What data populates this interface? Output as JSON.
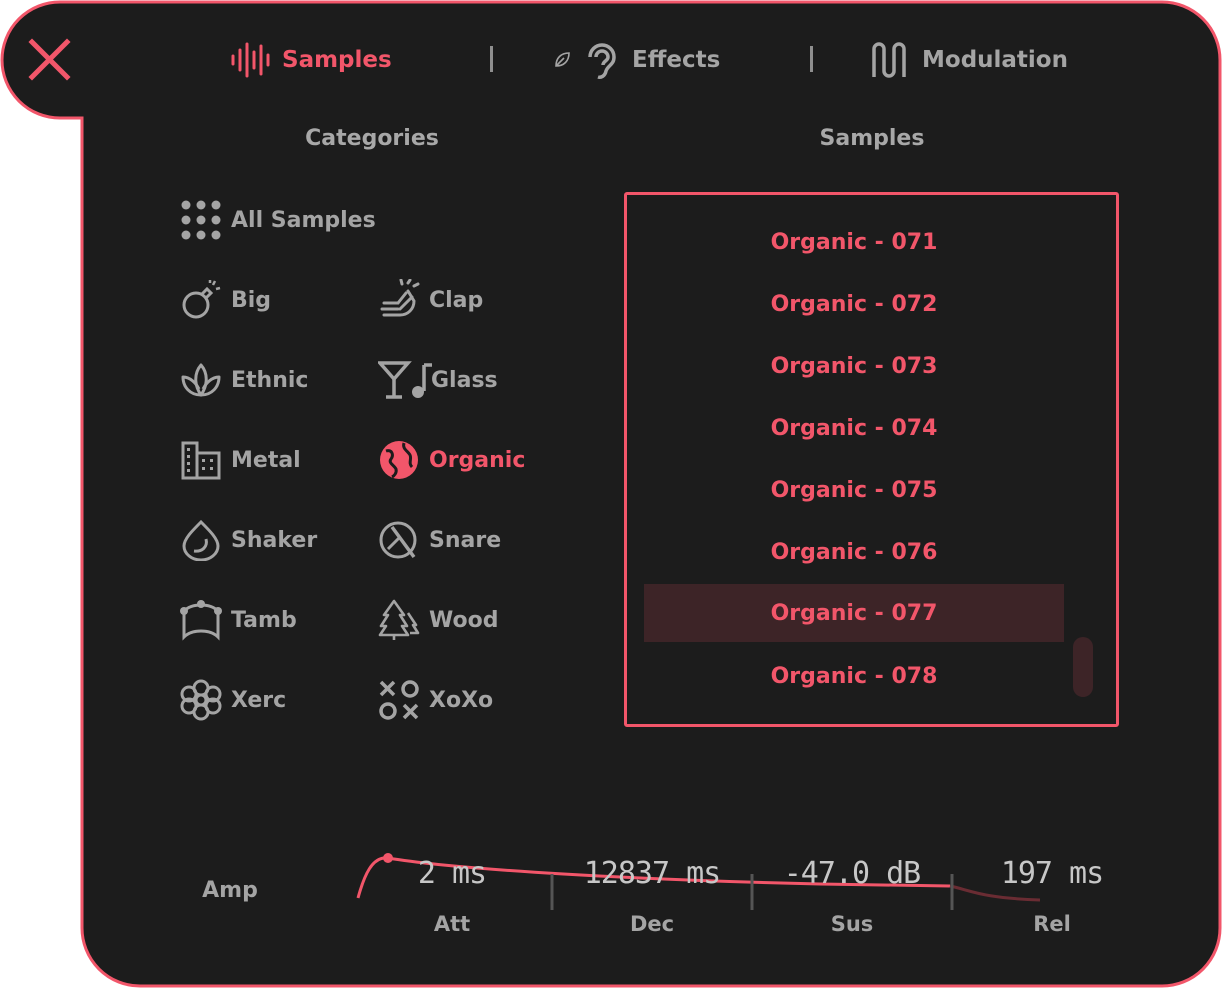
{
  "colors": {
    "accent": "#f2566a",
    "panel": "#1c1c1c",
    "text_muted": "#a4a4a4",
    "selected_row": "#3d2427"
  },
  "close_icon": "close-x-icon",
  "tabs": [
    {
      "label": "Samples",
      "icon": "waveform-bars-icon",
      "active": true
    },
    {
      "label": "Effects",
      "icon": "ear-icon",
      "active": false
    },
    {
      "label": "Modulation",
      "icon": "wave-squiggle-icon",
      "active": false
    }
  ],
  "categories": {
    "heading": "Categories",
    "all_label": "All Samples",
    "items": [
      {
        "label": "Big",
        "icon": "bomb-icon"
      },
      {
        "label": "Clap",
        "icon": "clap-hands-icon"
      },
      {
        "label": "Ethnic",
        "icon": "lotus-icon"
      },
      {
        "label": "Glass",
        "icon": "glass-note-icon"
      },
      {
        "label": "Metal",
        "icon": "building-icon"
      },
      {
        "label": "Organic",
        "icon": "globe-icon",
        "selected": true
      },
      {
        "label": "Shaker",
        "icon": "drop-icon"
      },
      {
        "label": "Snare",
        "icon": "drum-stick-icon"
      },
      {
        "label": "Tamb",
        "icon": "tambourine-icon"
      },
      {
        "label": "Wood",
        "icon": "trees-icon"
      },
      {
        "label": "Xerc",
        "icon": "flower-icon"
      },
      {
        "label": "XoXo",
        "icon": "xo-icon"
      }
    ]
  },
  "samples": {
    "heading": "Samples",
    "items": [
      "Organic - 071",
      "Organic - 072",
      "Organic - 073",
      "Organic - 074",
      "Organic - 075",
      "Organic - 076",
      "Organic - 077",
      "Organic - 078"
    ],
    "selected": "Organic - 077"
  },
  "envelope": {
    "label": "Amp",
    "attack": {
      "value": "2 ms",
      "label": "Att"
    },
    "decay": {
      "value": "12837 ms",
      "label": "Dec"
    },
    "sustain": {
      "value": "-47.0 dB",
      "label": "Sus"
    },
    "release": {
      "value": "197 ms",
      "label": "Rel"
    }
  }
}
